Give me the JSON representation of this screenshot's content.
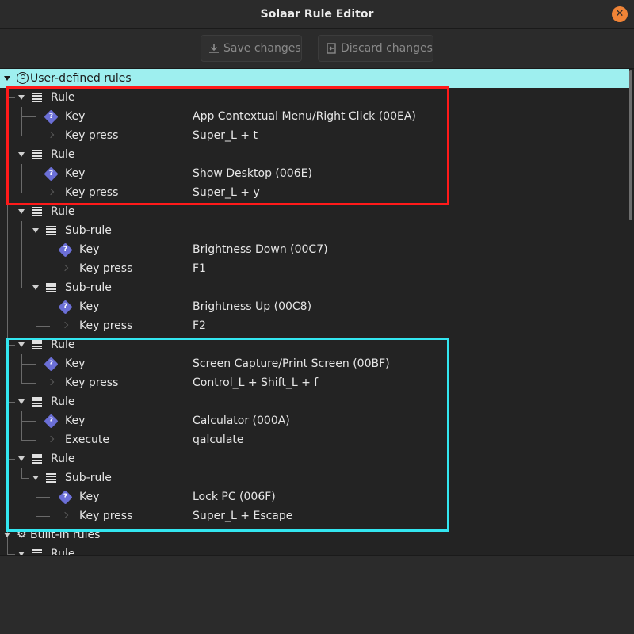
{
  "window": {
    "title": "Solaar Rule Editor",
    "close_icon": "close-icon"
  },
  "toolbar": {
    "save_label": "Save changes",
    "discard_label": "Discard changes"
  },
  "tree": {
    "root_label": "User-defined rules",
    "builtin_label": "Built-in rules",
    "builtin_first_label": "Rule",
    "rule_label": "Rule",
    "subrule_label": "Sub-rule",
    "key_label": "Key",
    "keypress_label": "Key press",
    "execute_label": "Execute",
    "values": {
      "r1_key": "App Contextual Menu/Right Click (00EA)",
      "r1_press": "Super_L + t",
      "r2_key": "Show Desktop (006E)",
      "r2_press": "Super_L + y",
      "r3s1_key": "Brightness Down (00C7)",
      "r3s1_press": "F1",
      "r3s2_key": "Brightness Up (00C8)",
      "r3s2_press": "F2",
      "r4_key": "Screen Capture/Print Screen (00BF)",
      "r4_press": "Control_L + Shift_L + f",
      "r5_key": "Calculator (000A)",
      "r5_exec": "qalculate",
      "r6s1_key": "Lock PC (006F)",
      "r6s1_press": "Super_L + Escape"
    }
  },
  "colors": {
    "accent_selection": "#9eefef",
    "highlight_red": "#ff1a1a",
    "highlight_cyan": "#33e6f0",
    "close": "#f08437"
  }
}
